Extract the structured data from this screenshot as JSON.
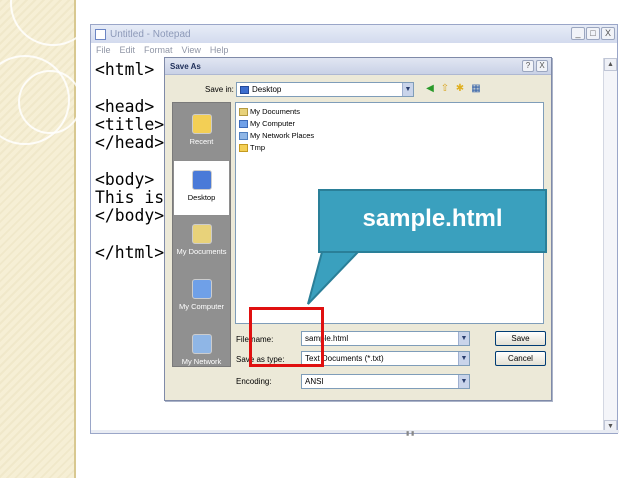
{
  "notepad": {
    "title": "Untitled - Notepad",
    "menu": [
      "File",
      "Edit",
      "Format",
      "View",
      "Help"
    ],
    "lines": [
      "<html>",
      "",
      "<head>",
      "<title>",
      "</head>",
      "",
      "<body>",
      "This is",
      "</body>",
      "",
      "</html>"
    ],
    "window_buttons": [
      "_",
      "□",
      "X"
    ]
  },
  "dialog": {
    "title": "Save As",
    "save_in_label": "Save in:",
    "save_in_value": "Desktop",
    "places": [
      {
        "label": "Recent",
        "icon": "recent-icon"
      },
      {
        "label": "Desktop",
        "icon": "desktop-icon"
      },
      {
        "label": "My Documents",
        "icon": "my-documents-icon"
      },
      {
        "label": "My Computer",
        "icon": "my-computer-icon"
      },
      {
        "label": "My Network",
        "icon": "my-network-icon"
      }
    ],
    "files": [
      "My Documents",
      "My Computer",
      "My Network Places",
      "Tmp"
    ],
    "file_name_label": "File name:",
    "file_name_value": "sample.html",
    "save_as_type_label": "Save as type:",
    "save_as_type_value": "Text Documents (*.txt)",
    "encoding_label": "Encoding:",
    "encoding_value": "ANSI",
    "save_button": "Save",
    "cancel_button": "Cancel",
    "window_buttons": [
      "?",
      "X"
    ]
  },
  "callout": {
    "text": "sample.html",
    "color": "#3aa0be"
  },
  "colors": {
    "highlight": "#e01010",
    "dialog_bg": "#ece9d8"
  }
}
